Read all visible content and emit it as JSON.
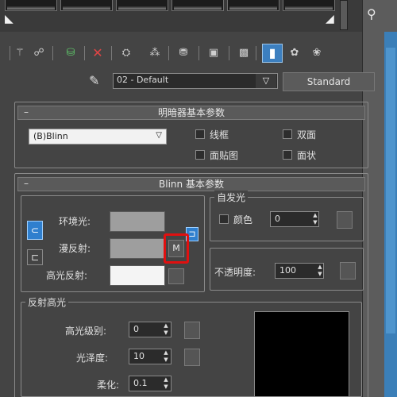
{
  "material": {
    "name": "02 - Default",
    "type_button": "Standard"
  },
  "toolbar": {
    "icons": [
      "get-material-icon",
      "put-to-scene-icon",
      "assign-to-selection-icon",
      "reset-map-icon",
      "make-copy-icon",
      "make-unique-icon",
      "put-to-library-icon",
      "material-id-channel-icon",
      "show-shaded-icon",
      "show-end-result-icon",
      "go-to-parent-icon",
      "go-forward-to-sibling-icon"
    ]
  },
  "shader_basic": {
    "title": "明暗器基本参数",
    "shader_selected": "(B)Blinn",
    "wire_label": "线框",
    "two_sided_label": "双面",
    "face_map_label": "面贴图",
    "faceted_label": "面状"
  },
  "blinn_basic": {
    "title": "Blinn 基本参数",
    "ambient_label": "环境光:",
    "diffuse_label": "漫反射:",
    "specular_label": "高光反射:",
    "diffuse_map_label": "M",
    "self_illum": {
      "label": "自发光",
      "color_label": "颜色",
      "value": "0"
    },
    "opacity": {
      "label": "不透明度:",
      "value": "100"
    },
    "colors": {
      "ambient": "#9e9e9e",
      "diffuse": "#9e9e9e",
      "specular": "#f4f4f4",
      "highlight_callout": "#e01010",
      "lock_button": "#2f7fce"
    }
  },
  "specular_highlights": {
    "label": "反射高光",
    "level_label": "高光级别:",
    "level_value": "0",
    "glossiness_label": "光泽度:",
    "glossiness_value": "10",
    "soften_label": "柔化:",
    "soften_value": "0.1"
  }
}
